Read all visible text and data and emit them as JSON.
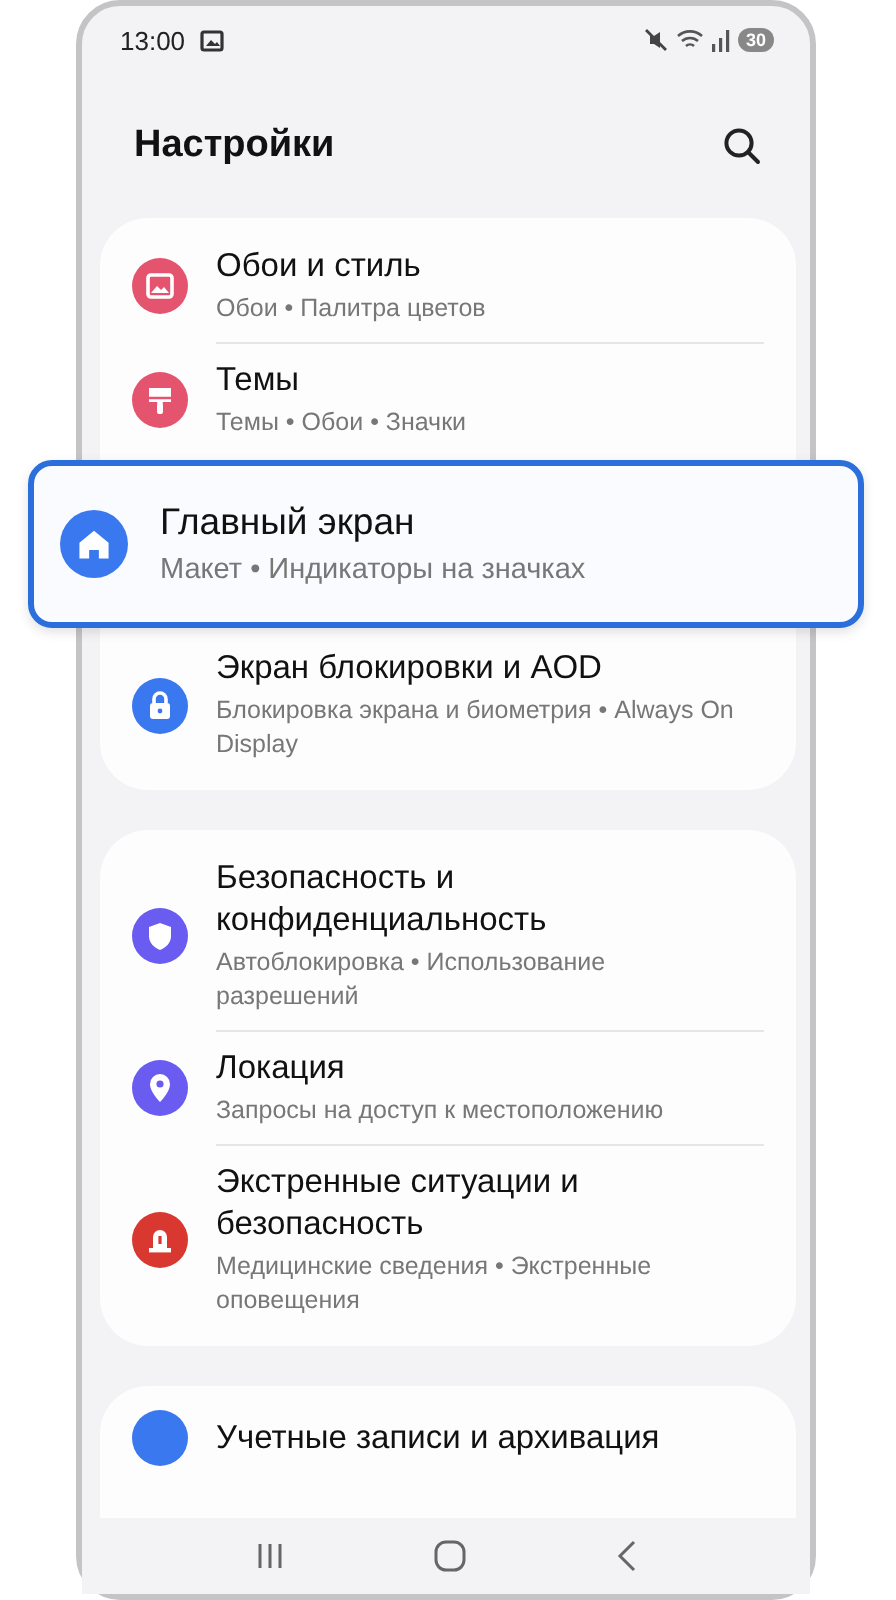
{
  "status_bar": {
    "time": "13:00",
    "battery": "30"
  },
  "header": {
    "title": "Настройки"
  },
  "groups": [
    {
      "items": [
        {
          "kind": "row",
          "color": "#e5546f",
          "title": "Обои и стиль",
          "subtitle": "Обои • Палитра цветов"
        },
        {
          "kind": "row",
          "color": "#e5546f",
          "title": "Темы",
          "subtitle": "Темы • Обои • Значки"
        },
        {
          "kind": "callout",
          "color": "#3a78f0",
          "title": "Главный экран",
          "subtitle": "Макет • Индикаторы на значках"
        },
        {
          "kind": "row",
          "color": "#3a78f0",
          "title": "Экран блокировки и AOD",
          "subtitle": "Блокировка экрана и биометрия • Always On Display"
        }
      ]
    },
    {
      "items": [
        {
          "kind": "row",
          "color": "#6a5cf0",
          "title": "Безопасность и конфиденциальность",
          "subtitle": "Автоблокировка • Использование разрешений"
        },
        {
          "kind": "row",
          "color": "#6a5cf0",
          "title": "Локация",
          "subtitle": "Запросы на доступ к местоположению"
        },
        {
          "kind": "row",
          "color": "#d8382f",
          "title": "Экстренные ситуации и безопасность",
          "subtitle": "Медицинские сведения • Экстренные оповещения"
        }
      ]
    },
    {
      "items": [
        {
          "kind": "row",
          "color": "#3a78f0",
          "title": "Учетные записи и архивация"
        }
      ]
    }
  ]
}
